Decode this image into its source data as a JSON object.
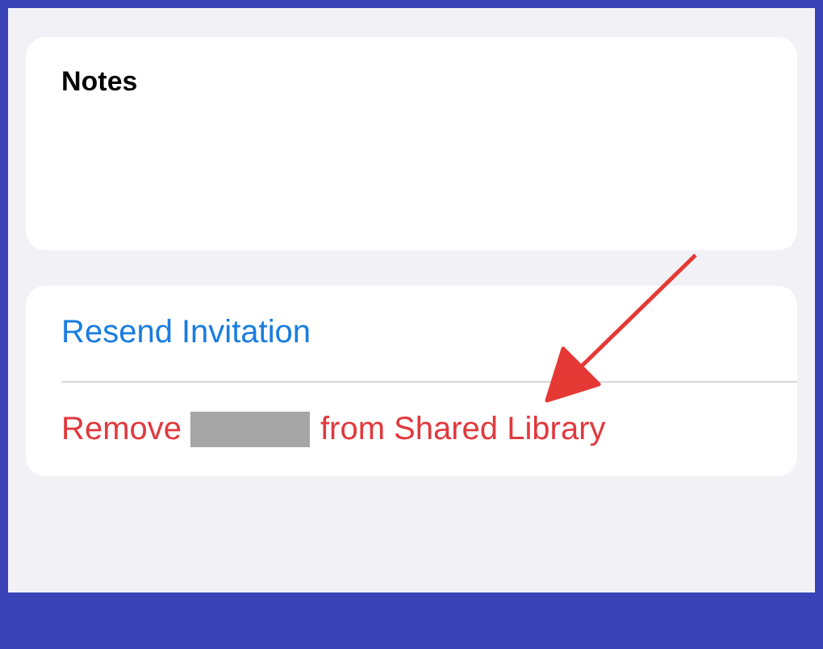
{
  "notes": {
    "label": "Notes"
  },
  "actions": [
    {
      "kind": "link",
      "label": "Resend Invitation"
    },
    {
      "kind": "destructive",
      "label_before": "Remove",
      "label_after": "from Shared Library"
    }
  ]
}
